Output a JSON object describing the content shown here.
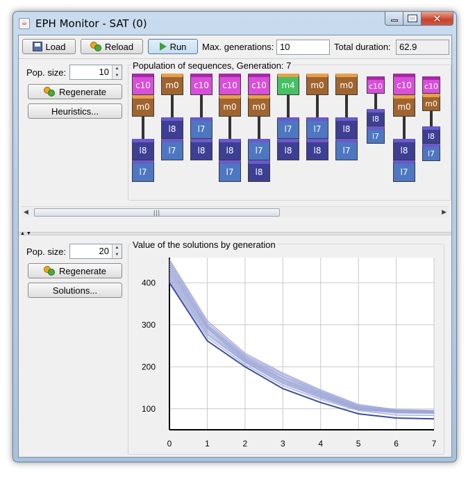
{
  "window": {
    "title": "EPH Monitor - SAT (0)",
    "app_icon": "java-cup-icon"
  },
  "toolbar": {
    "load_label": "Load",
    "reload_label": "Reload",
    "run_label": "Run",
    "max_generations_label": "Max. generations:",
    "max_generations_value": "10",
    "total_duration_label": "Total duration:",
    "total_duration_value": "62.9"
  },
  "heuristics_panel": {
    "pop_size_label": "Pop. size:",
    "pop_size_value": "10",
    "regenerate_label": "Regenerate",
    "heuristics_label": "Heuristics...",
    "population_title": "Population of sequences, Generation: 7",
    "sequences": [
      {
        "blocks": [
          "c10",
          "m0"
        ],
        "blocks2": [
          "l8",
          "l7"
        ]
      },
      {
        "blocks": [
          "m0"
        ],
        "blocks2": [
          "l8",
          "l7"
        ]
      },
      {
        "blocks": [
          "c10"
        ],
        "blocks2": [
          "l7",
          "l8"
        ]
      },
      {
        "blocks": [
          "c10",
          "m0"
        ],
        "blocks2": [
          "l8",
          "l7"
        ]
      },
      {
        "blocks": [
          "c10",
          "m0"
        ],
        "blocks2": [
          "l7",
          "l8"
        ]
      },
      {
        "blocks": [
          "m4"
        ],
        "blocks2": [
          "l7",
          "l8"
        ]
      },
      {
        "blocks": [
          "m0"
        ],
        "blocks2": [
          "l7",
          "l8"
        ]
      },
      {
        "blocks": [
          "m0"
        ],
        "blocks2": [
          "l8",
          "l7"
        ]
      },
      {
        "blocks": [
          "c10"
        ],
        "blocks2": [
          "l8",
          "l7"
        ]
      },
      {
        "blocks": [
          "c10",
          "m0"
        ],
        "blocks2": [
          "l8",
          "l7"
        ]
      },
      {
        "blocks": [
          "c10",
          "m0"
        ],
        "blocks2": [
          "l8",
          "l7"
        ]
      }
    ],
    "colors": {
      "c10": "#d84fd8",
      "m0": "#a0652f",
      "m4": "#45c163",
      "l8": "#3d3f94",
      "l7": "#4d77c2"
    }
  },
  "solutions_panel": {
    "pop_size_label": "Pop. size:",
    "pop_size_value": "20",
    "regenerate_label": "Regenerate",
    "solutions_label": "Solutions..."
  },
  "chart_data": {
    "type": "line",
    "title": "Value of the solutions by generation",
    "xlabel": "",
    "ylabel": "",
    "x": [
      0,
      1,
      2,
      3,
      4,
      5,
      6,
      7
    ],
    "xlim": [
      0,
      7
    ],
    "ylim": [
      50,
      460
    ],
    "yticks": [
      100,
      200,
      300,
      400
    ],
    "grid": true,
    "legend": "none",
    "line_color": "#9fa8d8",
    "best_line_color": "#3b4ea0",
    "best_series": [
      400,
      262,
      200,
      148,
      115,
      88,
      78,
      76
    ],
    "series": [
      {
        "values": [
          455,
          310,
          232,
          185,
          145,
          110,
          98,
          96
        ]
      },
      {
        "values": [
          450,
          305,
          228,
          182,
          142,
          108,
          97,
          95
        ]
      },
      {
        "values": [
          445,
          300,
          225,
          178,
          140,
          106,
          96,
          95
        ]
      },
      {
        "values": [
          440,
          298,
          222,
          176,
          138,
          104,
          95,
          94
        ]
      },
      {
        "values": [
          435,
          295,
          220,
          172,
          136,
          103,
          94,
          93
        ]
      },
      {
        "values": [
          430,
          292,
          218,
          170,
          134,
          102,
          93,
          92
        ]
      },
      {
        "values": [
          425,
          290,
          216,
          168,
          132,
          101,
          93,
          92
        ]
      },
      {
        "values": [
          420,
          285,
          214,
          165,
          130,
          100,
          92,
          91
        ]
      },
      {
        "values": [
          415,
          280,
          212,
          162,
          128,
          99,
          91,
          90
        ]
      },
      {
        "values": [
          410,
          276,
          210,
          160,
          126,
          98,
          90,
          89
        ]
      },
      {
        "values": [
          405,
          270,
          205,
          155,
          122,
          96,
          85,
          84
        ]
      },
      {
        "values": [
          400,
          262,
          200,
          148,
          115,
          88,
          78,
          76
        ]
      }
    ]
  }
}
